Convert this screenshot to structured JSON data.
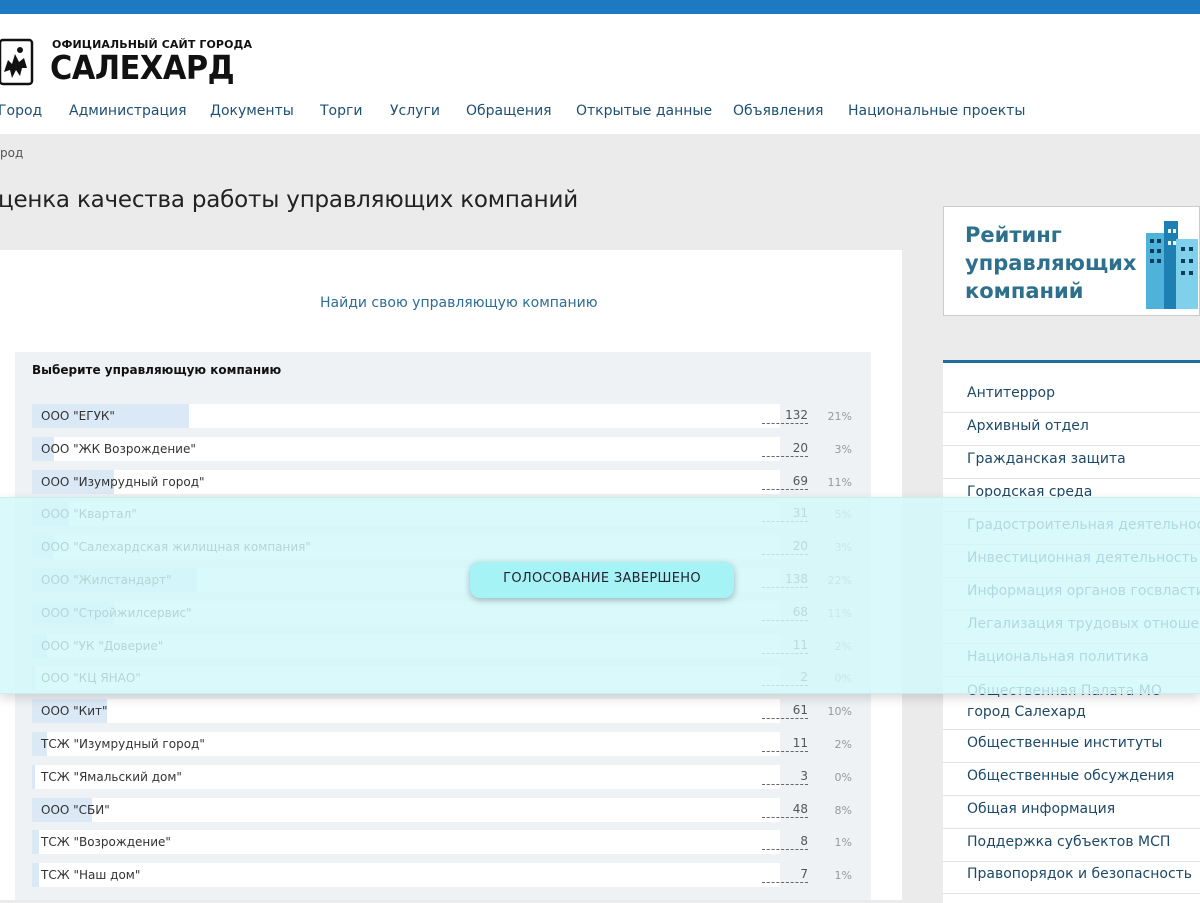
{
  "header": {
    "logo_small": "ОФИЦИАЛЬНЫЙ САЙТ ГОРОДА",
    "logo_big": "САЛЕХАРД",
    "nav": [
      "Город",
      "Администрация",
      "Документы",
      "Торги",
      "Услуги",
      "Обращения",
      "Открытые данные",
      "Объявления",
      "Национальные проекты"
    ]
  },
  "breadcrumb": "род",
  "page_title": "ценка качества работы управляющих компаний",
  "poll": {
    "find_link": "Найди свою управляющую компанию",
    "question": "Выберите управляющую компанию",
    "rows": [
      {
        "label": "ООО \"ЕГУК\"",
        "count": "132",
        "percent": "21%",
        "share": 0.21
      },
      {
        "label": "ООО \"ЖК Возрождение\"",
        "count": "20",
        "percent": "3%",
        "share": 0.03
      },
      {
        "label": "ООО \"Изумрудный город\"",
        "count": "69",
        "percent": "11%",
        "share": 0.11
      },
      {
        "label": "ООО \"Квартал\"",
        "count": "31",
        "percent": "5%",
        "share": 0.05
      },
      {
        "label": "ООО \"Салехардская жилищная компания\"",
        "count": "20",
        "percent": "3%",
        "share": 0.03
      },
      {
        "label": "ООО \"Жилстандарт\"",
        "count": "138",
        "percent": "22%",
        "share": 0.22
      },
      {
        "label": "ООО \"Стройжилсервис\"",
        "count": "68",
        "percent": "11%",
        "share": 0.11
      },
      {
        "label": "ООО \"УК \"Доверие\"",
        "count": "11",
        "percent": "2%",
        "share": 0.02
      },
      {
        "label": "ООО \"КЦ ЯНАО\"",
        "count": "2",
        "percent": "0%",
        "share": 0.0
      },
      {
        "label": "ООО \"Кит\"",
        "count": "61",
        "percent": "10%",
        "share": 0.1
      },
      {
        "label": "ТСЖ \"Изумрудный город\"",
        "count": "11",
        "percent": "2%",
        "share": 0.02
      },
      {
        "label": "ТСЖ \"Ямальский дом\"",
        "count": "3",
        "percent": "0%",
        "share": 0.0
      },
      {
        "label": "ООО \"СБИ\"",
        "count": "48",
        "percent": "8%",
        "share": 0.08
      },
      {
        "label": "ТСЖ \"Возрождение\"",
        "count": "8",
        "percent": "1%",
        "share": 0.01
      },
      {
        "label": "ТСЖ \"Наш дом\"",
        "count": "7",
        "percent": "1%",
        "share": 0.01
      }
    ],
    "status_badge": "ГОЛОСОВАНИЕ ЗАВЕРШЕНО"
  },
  "sidebar": {
    "banner_text": "Рейтинг управляющих компаний",
    "menu": [
      "Антитеррор",
      "Архивный отдел",
      "Гражданская защита",
      "Городская среда",
      "Градостроительная деятельность",
      "Инвестиционная деятельность",
      "Информация органов госвласти",
      "Легализация трудовых отношений",
      "Национальная политика",
      "Общественная Палата МО город Салехард",
      "Общественные институты",
      "Общественные обсуждения",
      "Общая информация",
      "Поддержка субъектов МСП",
      "Правопорядок и безопасность"
    ]
  },
  "colors": {
    "accent": "#1d7ac2",
    "nav_text": "#1f4f72",
    "bar_fill": "#dbe9f7",
    "overlay": "#d2f8fa",
    "badge": "#a6f3f5"
  }
}
